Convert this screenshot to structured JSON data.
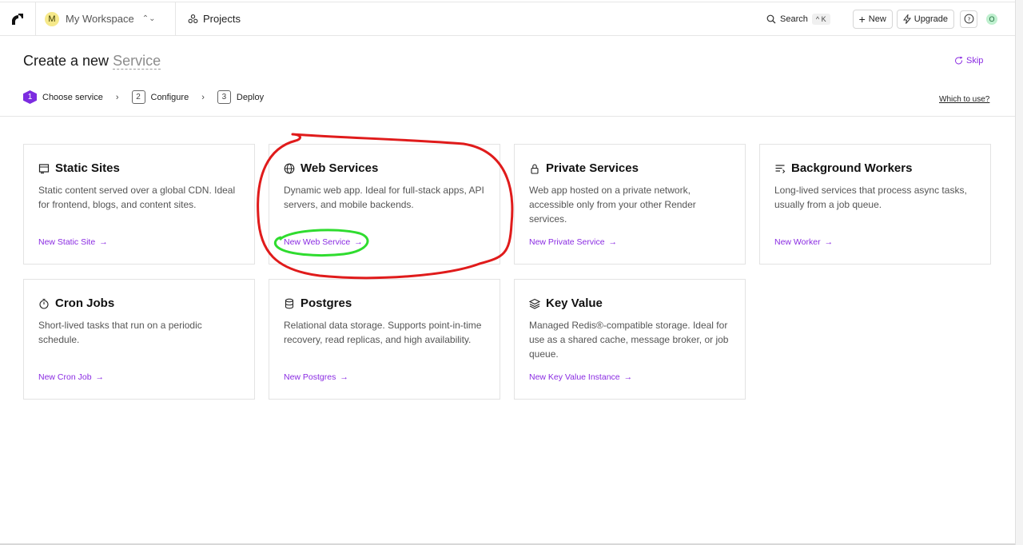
{
  "topbar": {
    "workspace_initial": "M",
    "workspace_name": "My Workspace",
    "projects_label": "Projects",
    "search_label": "Search",
    "search_shortcut": "^ K",
    "new_label": "New",
    "upgrade_label": "Upgrade",
    "user_initial": "O"
  },
  "header": {
    "title_prefix": "Create a new",
    "title_highlight": "Service",
    "skip_label": "Skip",
    "which_label": "Which to use?"
  },
  "steps": [
    {
      "num": "1",
      "label": "Choose service"
    },
    {
      "num": "2",
      "label": "Configure"
    },
    {
      "num": "3",
      "label": "Deploy"
    }
  ],
  "cards": [
    {
      "title": "Static Sites",
      "desc": "Static content served over a global CDN. Ideal for frontend, blogs, and content sites.",
      "link": "New Static Site",
      "icon": "browser-icon"
    },
    {
      "title": "Web Services",
      "desc": "Dynamic web app. Ideal for full-stack apps, API servers, and mobile backends.",
      "link": "New Web Service",
      "icon": "globe-icon"
    },
    {
      "title": "Private Services",
      "desc": "Web app hosted on a private network, accessible only from your other Render services.",
      "link": "New Private Service",
      "icon": "lock-icon"
    },
    {
      "title": "Background Workers",
      "desc": "Long-lived services that process async tasks, usually from a job queue.",
      "link": "New Worker",
      "icon": "list-icon"
    },
    {
      "title": "Cron Jobs",
      "desc": "Short-lived tasks that run on a periodic schedule.",
      "link": "New Cron Job",
      "icon": "timer-icon"
    },
    {
      "title": "Postgres",
      "desc": "Relational data storage. Supports point-in-time recovery, read replicas, and high availability.",
      "link": "New Postgres",
      "icon": "database-icon"
    },
    {
      "title": "Key Value",
      "desc": "Managed Redis®-compatible storage. Ideal for use as a shared cache, message broker, or job queue.",
      "link": "New Key Value Instance",
      "icon": "layers-icon"
    }
  ],
  "colors": {
    "accent": "#8a2be2",
    "step_active": "#7c2ce0",
    "annotation_red": "#e01b1b",
    "annotation_green": "#2fdc2f"
  }
}
